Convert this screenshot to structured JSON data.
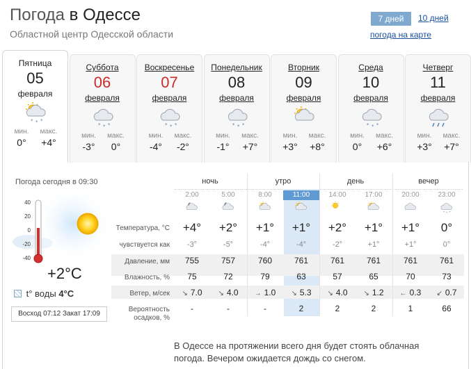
{
  "header": {
    "title_prefix": "Погода",
    "title_city": "в Одессе",
    "subtitle": "Областной центр Одесской области",
    "tab_7": "7 дней",
    "tab_10": "10 дней",
    "map_link": "погода на карте"
  },
  "days": [
    {
      "name": "Пятница",
      "num": "05",
      "month": "февраля",
      "min_label": "мин.",
      "max_label": "макс.",
      "min": "0°",
      "max": "+4°",
      "icon": "partly-sunny-snow-icon",
      "red": false,
      "active": true
    },
    {
      "name": "Суббота",
      "num": "06",
      "month": "февраля",
      "min_label": "мин.",
      "max_label": "макс.",
      "min": "-3°",
      "max": "0°",
      "icon": "cloud-snow-icon",
      "red": true,
      "active": false
    },
    {
      "name": "Воскресенье",
      "num": "07",
      "month": "февраля",
      "min_label": "мин.",
      "max_label": "макс.",
      "min": "-4°",
      "max": "-2°",
      "icon": "cloud-snow-icon",
      "red": true,
      "active": false
    },
    {
      "name": "Понедельник",
      "num": "08",
      "month": "февраля",
      "min_label": "мин.",
      "max_label": "макс.",
      "min": "-1°",
      "max": "+7°",
      "icon": "cloud-snow-icon",
      "red": false,
      "active": false
    },
    {
      "name": "Вторник",
      "num": "09",
      "month": "февраля",
      "min_label": "мин.",
      "max_label": "макс.",
      "min": "+3°",
      "max": "+8°",
      "icon": "partly-sunny-icon",
      "red": false,
      "active": false
    },
    {
      "name": "Среда",
      "num": "10",
      "month": "февраля",
      "min_label": "мин.",
      "max_label": "макс.",
      "min": "0°",
      "max": "+6°",
      "icon": "cloud-snow-icon",
      "red": false,
      "active": false
    },
    {
      "name": "Четверг",
      "num": "11",
      "month": "февраля",
      "min_label": "мин.",
      "max_label": "макс.",
      "min": "+3°",
      "max": "+7°",
      "icon": "cloud-rain-icon",
      "red": false,
      "active": false
    }
  ],
  "now": {
    "title": "Погода сегодня в 09:30",
    "scale": [
      "40",
      "20",
      "0",
      "-20",
      "-40"
    ],
    "temp": "+2°C",
    "water_label": "t° воды",
    "water_value": "4°C",
    "sunrise_label": "Восход",
    "sunrise": "07:12",
    "sunset_label": "Закат",
    "sunset": "17:09",
    "thermometer_level_c": 2
  },
  "segments": [
    "ночь",
    "утро",
    "день",
    "вечер"
  ],
  "times": [
    "2:00",
    "5:00",
    "8:00",
    "11:00",
    "14:00",
    "17:00",
    "20:00",
    "23:00"
  ],
  "hour_icons": [
    "night-cloud-icon",
    "night-cloud-icon",
    "partly-cloudy-icon",
    "partly-cloudy-icon",
    "sun-icon",
    "partly-cloudy-icon",
    "cloud-icon",
    "cloud-snow-icon"
  ],
  "row_labels": {
    "temp": "Температура, °С",
    "feels": "чувствуется как",
    "pressure": "Давление, мм",
    "humidity": "Влажность, %",
    "wind": "Ветер, м/сек",
    "precip_1": "Вероятность",
    "precip_2": "осадков, %"
  },
  "temps": [
    "+4°",
    "+2°",
    "+1°",
    "+1°",
    "+2°",
    "+1°",
    "+1°",
    "0°"
  ],
  "feels": [
    "-3°",
    "-5°",
    "-4°",
    "-4°",
    "-2°",
    "+1°",
    "+1°",
    "0°"
  ],
  "pressure": [
    "755",
    "757",
    "760",
    "761",
    "761",
    "761",
    "761",
    "761"
  ],
  "humidity": [
    "75",
    "72",
    "79",
    "63",
    "57",
    "65",
    "70",
    "73"
  ],
  "wind": [
    "7.0",
    "4.0",
    "1.0",
    "5.3",
    "4.0",
    "1.2",
    "0.3",
    "0.7"
  ],
  "wind_arrows": [
    "↘",
    "↘",
    "→",
    "↘",
    "↘",
    "↘",
    "←",
    "↙"
  ],
  "precip": [
    "-",
    "-",
    "-",
    "2",
    "2",
    "2",
    "1",
    "66"
  ],
  "description": "В Одессе на протяжении всего дня будет стоять облачная погода. Вечером ожидается дождь со снегом.",
  "colors": {
    "accent": "#7fa9cf",
    "highlight": "#dbe9f6",
    "highlight_time": "#5f9bd2",
    "weekend": "#c62d2d"
  }
}
